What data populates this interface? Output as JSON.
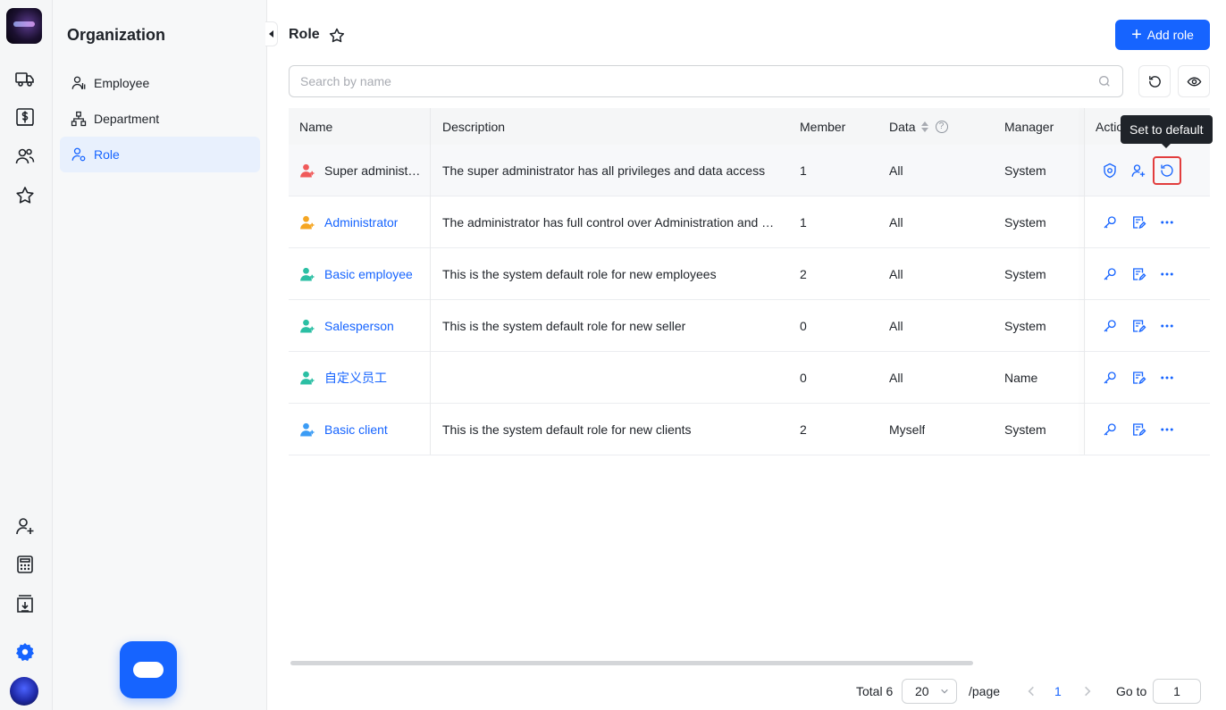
{
  "rail": {
    "icons": [
      "truck-icon",
      "dollar-doc-icon",
      "users-icon",
      "star-icon",
      "add-user-icon",
      "calculator-icon",
      "download-box-icon",
      "settings-icon"
    ]
  },
  "sidebar": {
    "title": "Organization",
    "items": [
      {
        "label": "Employee",
        "icon": "employee-icon",
        "active": false
      },
      {
        "label": "Department",
        "icon": "department-icon",
        "active": false
      },
      {
        "label": "Role",
        "icon": "role-icon",
        "active": true
      }
    ]
  },
  "header": {
    "title": "Role",
    "add_button": "Add role"
  },
  "search": {
    "placeholder": "Search by name"
  },
  "table": {
    "columns": [
      "Name",
      "Description",
      "Member",
      "Data",
      "Manager",
      "Actio"
    ],
    "rows": [
      {
        "name": "Super administ…",
        "icon_color": "#f05a5a",
        "link": false,
        "description": "The super administrator has all privileges and data access",
        "member": "1",
        "data": "All",
        "manager": "System"
      },
      {
        "name": "Administrator",
        "icon_color": "#f5a623",
        "link": true,
        "description": "The administrator has full control over Administration and …",
        "member": "1",
        "data": "All",
        "manager": "System"
      },
      {
        "name": "Basic employee",
        "icon_color": "#2bbfa4",
        "link": true,
        "description": "This is the system default role for new employees",
        "member": "2",
        "data": "All",
        "manager": "System"
      },
      {
        "name": "Salesperson",
        "icon_color": "#2bbfa4",
        "link": true,
        "description": "This is the system default role for new seller",
        "member": "0",
        "data": "All",
        "manager": "System"
      },
      {
        "name": "自定义员工",
        "icon_color": "#2bbfa4",
        "link": true,
        "description": "",
        "member": "0",
        "data": "All",
        "manager": "Name"
      },
      {
        "name": "Basic client",
        "icon_color": "#3b9cf5",
        "link": true,
        "description": "This is the system default role for new clients",
        "member": "2",
        "data": "Myself",
        "manager": "System"
      }
    ]
  },
  "tooltip": "Set to default",
  "pagination": {
    "total_label": "Total 6",
    "page_size": "20",
    "per_page": "/page",
    "current_page": "1",
    "goto_label": "Go to",
    "goto_value": "1"
  },
  "colors": {
    "accent": "#1664ff",
    "highlight": "#e23d3d"
  }
}
